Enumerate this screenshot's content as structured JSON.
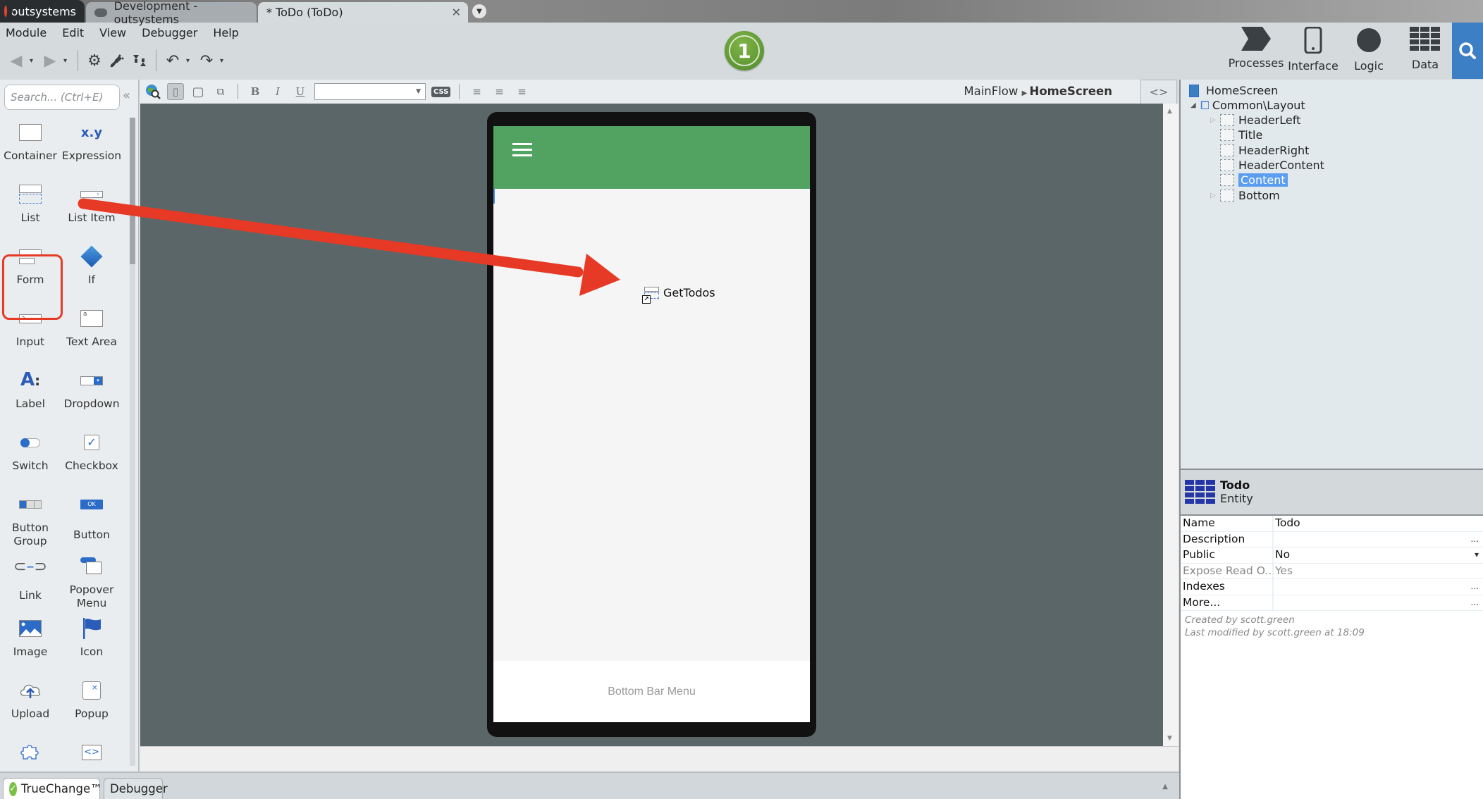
{
  "tabs": {
    "brand": "outsystems",
    "environment": "Development - outsystems",
    "module": "* ToDo (ToDo)"
  },
  "menu": [
    "Module",
    "Edit",
    "View",
    "Debugger",
    "Help"
  ],
  "status_badge": "1",
  "nav": {
    "processes": "Processes",
    "interface": "Interface",
    "logic": "Logic",
    "data": "Data"
  },
  "palette": {
    "search_placeholder": "Search... (Ctrl+E)",
    "items": [
      {
        "label": "Container",
        "icon": "container-icon"
      },
      {
        "label": "Expression",
        "icon": "expression-icon"
      },
      {
        "label": "List",
        "icon": "list-icon",
        "highlighted": true
      },
      {
        "label": "List Item",
        "icon": "list-item-icon"
      },
      {
        "label": "Form",
        "icon": "form-icon"
      },
      {
        "label": "If",
        "icon": "if-icon"
      },
      {
        "label": "Input",
        "icon": "input-icon"
      },
      {
        "label": "Text Area",
        "icon": "text-area-icon"
      },
      {
        "label": "Label",
        "icon": "label-icon"
      },
      {
        "label": "Dropdown",
        "icon": "dropdown-icon"
      },
      {
        "label": "Switch",
        "icon": "switch-icon"
      },
      {
        "label": "Checkbox",
        "icon": "checkbox-icon"
      },
      {
        "label": "Button Group",
        "icon": "button-group-icon"
      },
      {
        "label": "Button",
        "icon": "button-icon"
      },
      {
        "label": "Link",
        "icon": "link-icon"
      },
      {
        "label": "Popover Menu",
        "icon": "popover-menu-icon"
      },
      {
        "label": "Image",
        "icon": "image-icon"
      },
      {
        "label": "Icon",
        "icon": "flag-icon"
      },
      {
        "label": "Upload",
        "icon": "upload-icon"
      },
      {
        "label": "Popup",
        "icon": "popup-icon"
      },
      {
        "label": "",
        "icon": "block-icon"
      },
      {
        "label": "",
        "icon": "html-element-icon"
      }
    ],
    "expression_glyph": "x.y",
    "button_glyph": "OK"
  },
  "canvas_toolbar": {
    "css_label": "CSS",
    "font_value": ""
  },
  "breadcrumb": {
    "flow": "MainFlow",
    "screen": "HomeScreen"
  },
  "code_toggle": "<>",
  "phone": {
    "widget_label": "GetTodos",
    "bottom_bar": "Bottom Bar Menu",
    "header_color": "#52a362"
  },
  "tree": {
    "root": "HomeScreen",
    "block": "Common\\Layout",
    "placeholders": [
      {
        "label": "HeaderLeft",
        "expandable": true,
        "selected": false
      },
      {
        "label": "Title",
        "expandable": false,
        "selected": false
      },
      {
        "label": "HeaderRight",
        "expandable": false,
        "selected": false
      },
      {
        "label": "HeaderContent",
        "expandable": false,
        "selected": false
      },
      {
        "label": "Content",
        "expandable": false,
        "selected": true
      },
      {
        "label": "Bottom",
        "expandable": true,
        "selected": false
      }
    ]
  },
  "properties": {
    "title": "Todo",
    "type": "Entity",
    "rows": [
      {
        "key": "Name",
        "value": "Todo",
        "action": "",
        "dim": false
      },
      {
        "key": "Description",
        "value": "",
        "action": "...",
        "dim": false
      },
      {
        "key": "Public",
        "value": "No",
        "action": "▾",
        "dim": false
      },
      {
        "key": "Expose Read O...",
        "value": "Yes",
        "action": "",
        "dim": true
      },
      {
        "key": "Indexes",
        "value": "",
        "action": "...",
        "dim": false
      },
      {
        "key": "More...",
        "value": "",
        "action": "...",
        "dim": false
      }
    ],
    "created_by": "Created by scott.green",
    "modified_by": "Last modified by scott.green at 18:09"
  },
  "bottom_tabs": {
    "truechange": "TrueChange™",
    "debugger": "Debugger"
  },
  "colors": {
    "accent_blue": "#3d7fc4",
    "annotation_red": "#e63a26",
    "canvas": "#5b6668",
    "status_green": "#5a9a33"
  }
}
